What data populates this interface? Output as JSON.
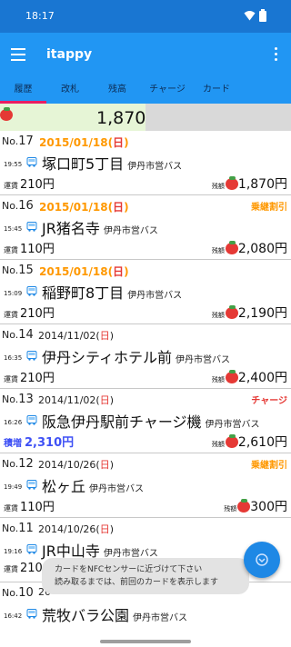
{
  "status_bar": {
    "time": "18:17"
  },
  "app_bar": {
    "title": "itappy"
  },
  "tabs": [
    {
      "label": "履歴"
    },
    {
      "label": "改札"
    },
    {
      "label": "残高"
    },
    {
      "label": "チャージ"
    },
    {
      "label": "カード"
    }
  ],
  "balance": {
    "text": "1,870",
    "level_fraction": 0.5
  },
  "labels": {
    "fare": "運賃",
    "remaining": "残額",
    "yen": "円",
    "charge_amount": "積増"
  },
  "entries": [
    {
      "no_label": "No.",
      "no": "17",
      "date": "2015/01/18",
      "dow": "日",
      "time": "19:55",
      "station": "塚口町5丁目",
      "operator": "伊丹市営バス",
      "fare": "210円",
      "remain": "1,870",
      "tag": ""
    },
    {
      "no_label": "No.",
      "no": "16",
      "date": "2015/01/18",
      "dow": "日",
      "time": "15:45",
      "station": "JR猪名寺",
      "operator": "伊丹市営バス",
      "fare": "110円",
      "remain": "2,080",
      "tag": "乗継割引"
    },
    {
      "no_label": "No.",
      "no": "15",
      "date": "2015/01/18",
      "dow": "日",
      "time": "15:09",
      "station": "稲野町8丁目",
      "operator": "伊丹市営バス",
      "fare": "210円",
      "remain": "2,190",
      "tag": ""
    },
    {
      "no_label": "No.",
      "no": "14",
      "date": "2014/11/02",
      "dow": "日",
      "time": "16:35",
      "station": "伊丹シティホテル前",
      "operator": "伊丹市営バス",
      "fare": "210円",
      "remain": "2,400",
      "tag": ""
    },
    {
      "no_label": "No.",
      "no": "13",
      "date": "2014/11/02",
      "dow": "日",
      "time": "16:26",
      "station": "阪急伊丹駅前チャージ機",
      "operator": "伊丹市営バス",
      "fare": "2,310円",
      "remain": "2,610",
      "tag": "チャージ"
    },
    {
      "no_label": "No.",
      "no": "12",
      "date": "2014/10/26",
      "dow": "日",
      "time": "19:49",
      "station": "松ヶ丘",
      "operator": "伊丹市営バス",
      "fare": "110円",
      "remain": "300",
      "tag": "乗継割引"
    },
    {
      "no_label": "No.",
      "no": "11",
      "date": "2014/10/26",
      "dow": "日",
      "time": "19:16",
      "station": "JR中山寺",
      "operator": "伊丹市営バス",
      "fare": "210",
      "remain": "",
      "tag": ""
    },
    {
      "no_label": "No.",
      "no": "10",
      "date": "20",
      "dow": "",
      "time": "16:42",
      "station": "荒牧バラ公園",
      "operator": "伊丹市営バス",
      "fare": "",
      "remain": "",
      "tag": ""
    }
  ],
  "toast": {
    "line1": "カードをNFCセンサーに近づけて下さい",
    "line2": "読み取るまでは、前回のカードを表示します"
  },
  "colors": {
    "status_bar": "#1976d2",
    "app_bar": "#2196f3",
    "tab_indicator": "#e91e63",
    "highlight_date": "#ff9800",
    "sunday": "#e53935",
    "charge_amount": "#3f51f5"
  },
  "icons": [
    "wifi-icon",
    "battery-icon",
    "menu-icon",
    "overflow-menu-icon",
    "tomato-icon",
    "bus-icon",
    "nfc-icon"
  ]
}
